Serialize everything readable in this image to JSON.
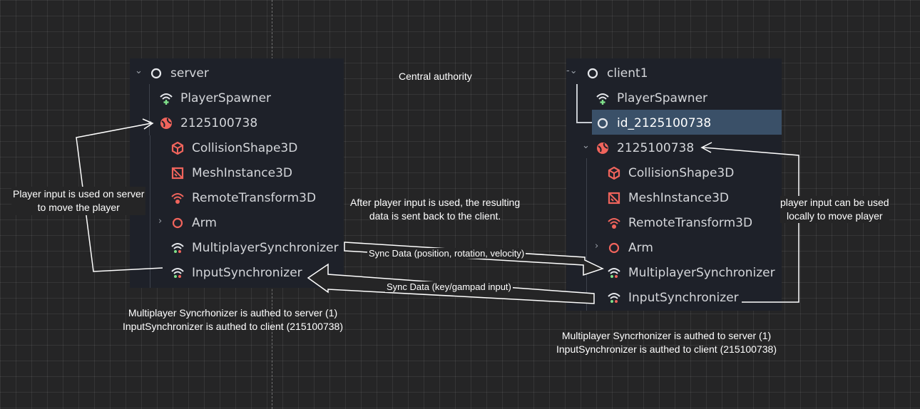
{
  "server_panel": {
    "root": "server",
    "spawner": "PlayerSpawner",
    "player": "2125100738",
    "collision": "CollisionShape3D",
    "mesh": "MeshInstance3D",
    "remote": "RemoteTransform3D",
    "arm": "Arm",
    "multiplayer_sync": "MultiplayerSynchronizer",
    "input_sync": "InputSynchronizer"
  },
  "client_panel": {
    "root": "client1",
    "spawner": "PlayerSpawner",
    "id_node": "id_2125100738",
    "player": "2125100738",
    "collision": "CollisionShape3D",
    "mesh": "MeshInstance3D",
    "remote": "RemoteTransform3D",
    "arm": "Arm",
    "multiplayer_sync": "MultiplayerSynchronizer",
    "input_sync": "InputSynchronizer"
  },
  "notes": {
    "central_authority": "Central authority",
    "server_input_line1": "Player input is used on server",
    "server_input_line2": "to move the player",
    "result_line1": "After player input is used, the resulting",
    "result_line2": "data is sent back to the client.",
    "client_input_line1": "player input can be used",
    "client_input_line2": "locally to move player",
    "sync_data_state": "Sync Data (position, rotation, velocity)",
    "sync_data_input": "Sync Data (key/gampad input)",
    "server_auth_line1": "Multiplayer Syncrhonizer is authed to server (1)",
    "server_auth_line2": "InputSynchronizer is authed to client (215100738)",
    "client_auth_line1": "Multiplayer Syncrhonizer is authed to server (1)",
    "client_auth_line2": "InputSynchronizer is authed to client (215100738)"
  },
  "icons": {
    "root": "node-circle-icon",
    "spawner": "wifi-plus-icon",
    "player": "globe-icon",
    "collision": "cube-icon",
    "mesh": "mesh-icon",
    "remote": "remote-transform-icon",
    "arm": "node-circle-icon",
    "sync": "wifi-sync-icon"
  },
  "colors": {
    "background": "#252526",
    "panel": "#1e2129",
    "selection": "#3a5068",
    "red_icon": "#f0645c",
    "green_icon": "#7fe08a",
    "text": "#d4d6da"
  }
}
